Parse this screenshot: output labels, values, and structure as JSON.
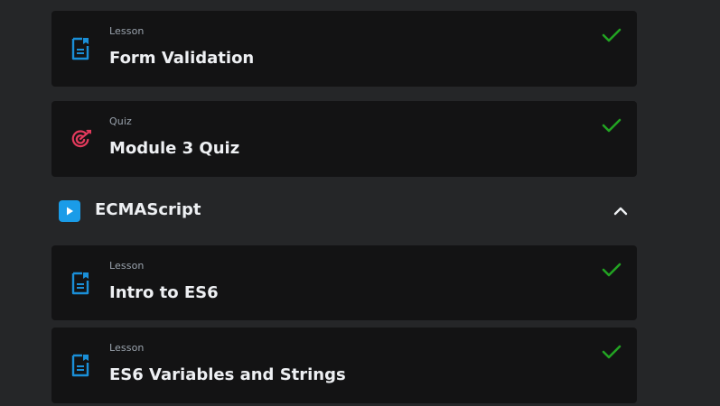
{
  "colors": {
    "background": "#252628",
    "card": "#131314",
    "lesson_icon": "#1a8fd8",
    "quiz_icon": "#e33a5c",
    "check": "#22a322",
    "section_play": "#1a9ce8"
  },
  "items_before": [
    {
      "type": "Lesson",
      "title": "Form Validation",
      "icon": "document-icon",
      "completed": true
    },
    {
      "type": "Quiz",
      "title": "Module 3 Quiz",
      "icon": "target-icon",
      "completed": true
    }
  ],
  "section": {
    "title": "ECMAScript",
    "icon": "play-icon",
    "expanded": true,
    "toggle_icon": "chevron-up-icon"
  },
  "items_after": [
    {
      "type": "Lesson",
      "title": "Intro to ES6",
      "icon": "document-icon",
      "completed": true
    },
    {
      "type": "Lesson",
      "title": "ES6 Variables and Strings",
      "icon": "document-icon",
      "completed": true
    }
  ]
}
